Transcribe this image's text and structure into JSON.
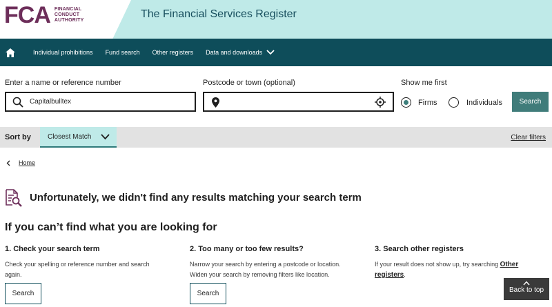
{
  "header": {
    "logo_mark": "FCA",
    "logo_text": [
      "FINANCIAL",
      "CONDUCT",
      "AUTHORITY"
    ],
    "title": "The Financial Services Register"
  },
  "nav": {
    "items": [
      {
        "label": "Individual prohibitions"
      },
      {
        "label": "Fund search"
      },
      {
        "label": "Other registers"
      },
      {
        "label": "Data and downloads"
      }
    ]
  },
  "search": {
    "name_label": "Enter a name or reference number",
    "name_value": "Capitalbulltex",
    "postcode_label": "Postcode or town (optional)",
    "postcode_value": "",
    "show_label": "Show me first",
    "options": [
      {
        "label": "Firms",
        "selected": true
      },
      {
        "label": "Individuals",
        "selected": false
      }
    ],
    "button": "Search"
  },
  "sort": {
    "label": "Sort by",
    "value": "Closest Match",
    "clear": "Clear filters"
  },
  "breadcrumb": {
    "home": "Home"
  },
  "results": {
    "no_results": "Unfortunately, we didn't find any results matching your search term",
    "help_title": "If you can’t find what you are looking for",
    "columns": [
      {
        "title": "1. Check your search term",
        "line1": "Check your spelling or reference number and search",
        "line2": "again.",
        "button": "Search"
      },
      {
        "title": "2. Too many or too few results?",
        "line1": "Narrow your search by entering a postcode or location.",
        "line2": "Widen your search by removing filters like location.",
        "button": "Search"
      },
      {
        "title": "3. Search other registers",
        "text_before": "If your result does not show up, try searching ",
        "link1": "Other",
        "link2": "registers",
        "text_after": "."
      }
    ]
  },
  "back_to_top": "Back to top",
  "colors": {
    "brand_purple": "#6d2e5a",
    "header_teal_light": "#bfeae8",
    "nav_teal_dark": "#0e4d5a",
    "button_teal": "#407c7a"
  }
}
